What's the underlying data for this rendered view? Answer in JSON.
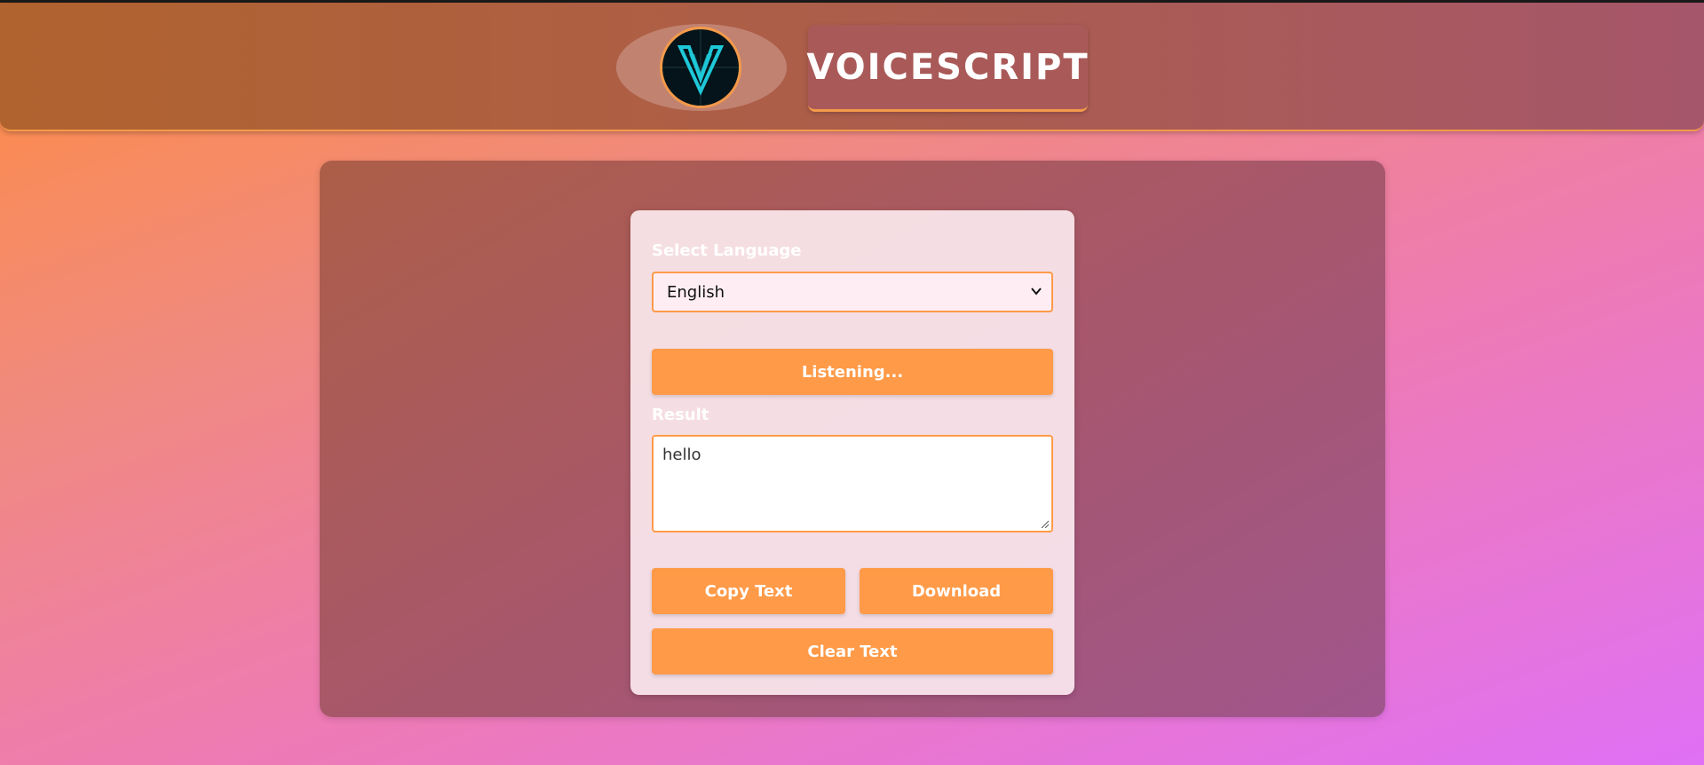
{
  "header": {
    "title": "VOICESCRIPT"
  },
  "colors": {
    "accent": "#ff9a48",
    "logo_mark": "#1fc8d8"
  },
  "form": {
    "language_label": "Select Language",
    "language_selected": "English",
    "listen_button": "Listening...",
    "result_label": "Result",
    "result_text": "hello",
    "copy_button": "Copy Text",
    "download_button": "Download",
    "clear_button": "Clear Text"
  }
}
